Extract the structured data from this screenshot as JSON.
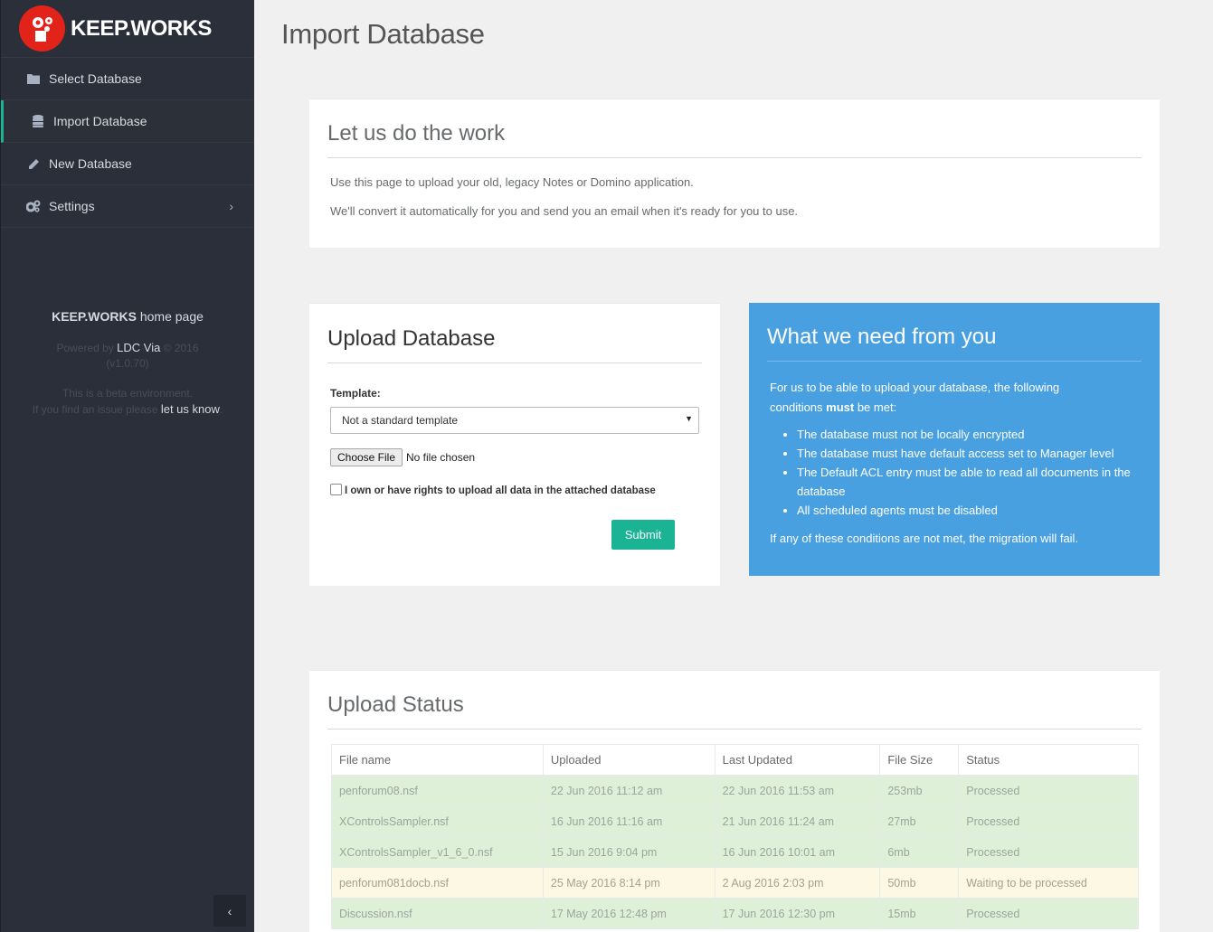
{
  "brand": {
    "name": "KEEP.WORKS",
    "logo_icon": "cog-logo-icon",
    "logo_color": "#e2231a"
  },
  "sidebar": {
    "items": [
      {
        "label": "Select Database",
        "icon": "folder-icon"
      },
      {
        "label": "Import Database",
        "icon": "database-icon",
        "active": true
      },
      {
        "label": "New Database",
        "icon": "pencil-icon"
      },
      {
        "label": "Settings",
        "icon": "cogs-icon",
        "chevron": "›"
      }
    ],
    "footer": {
      "home_bold": "KEEP.WORKS",
      "home_rest": " home page",
      "powered_prefix": "Powered by ",
      "powered_link": "LDC Via",
      "powered_suffix": " © 2016",
      "version": "(v1.0.70)",
      "beta_line": "This is a beta environment.",
      "issue_prefix": "If you find an issue please ",
      "issue_link": "let us know",
      "issue_suffix": "."
    },
    "collapse_glyph": "‹"
  },
  "page": {
    "title": "Import Database"
  },
  "intro": {
    "title": "Let us do the work",
    "line1": "Use this page to upload your old, legacy Notes or Domino application.",
    "line2": "We'll convert it automatically for you and send you an email when it's ready for you to use."
  },
  "upload": {
    "title": "Upload Database",
    "template_label": "Template:",
    "template_value": "Not a standard template",
    "choose_file": "Choose File",
    "no_file": "No file chosen",
    "rights_label": "I own or have rights to upload all data in the attached database",
    "submit": "Submit"
  },
  "needs": {
    "title": "What we need from you",
    "intro_a": "For us to be able to upload your database, the following",
    "intro_b": "conditions ",
    "intro_bold": "must",
    "intro_c": " be met:",
    "items": [
      "The database must not be locally encrypted",
      "The database must have default access set to Manager level",
      "The Default ACL entry must be able to read all documents in the database",
      "All scheduled agents must be disabled"
    ],
    "outro": "If any of these conditions are not met, the migration will fail.",
    "bg_color": "#49a0e0"
  },
  "status": {
    "title": "Upload Status",
    "columns": [
      "File name",
      "Uploaded",
      "Last Updated",
      "File Size",
      "Status"
    ],
    "rows": [
      [
        "penforum08.nsf",
        "22 Jun 2016 11:12 am",
        "22 Jun 2016 11:53 am",
        "253mb",
        "Processed"
      ],
      [
        "XControlsSampler.nsf",
        "16 Jun 2016 11:16 am",
        "21 Jun 2016 11:24 am",
        "27mb",
        "Processed"
      ],
      [
        "XControlsSampler_v1_6_0.nsf",
        "15 Jun 2016 9:04 pm",
        "16 Jun 2016 10:01 am",
        "6mb",
        "Processed"
      ],
      [
        "penforum081docb.nsf",
        "25 May 2016 8:14 pm",
        "2 Aug 2016 2:03 pm",
        "50mb",
        "Waiting to be processed"
      ],
      [
        "Discussion.nsf",
        "17 May 2016 12:48 pm",
        "17 Jun 2016 12:30 pm",
        "15mb",
        "Processed"
      ]
    ]
  }
}
